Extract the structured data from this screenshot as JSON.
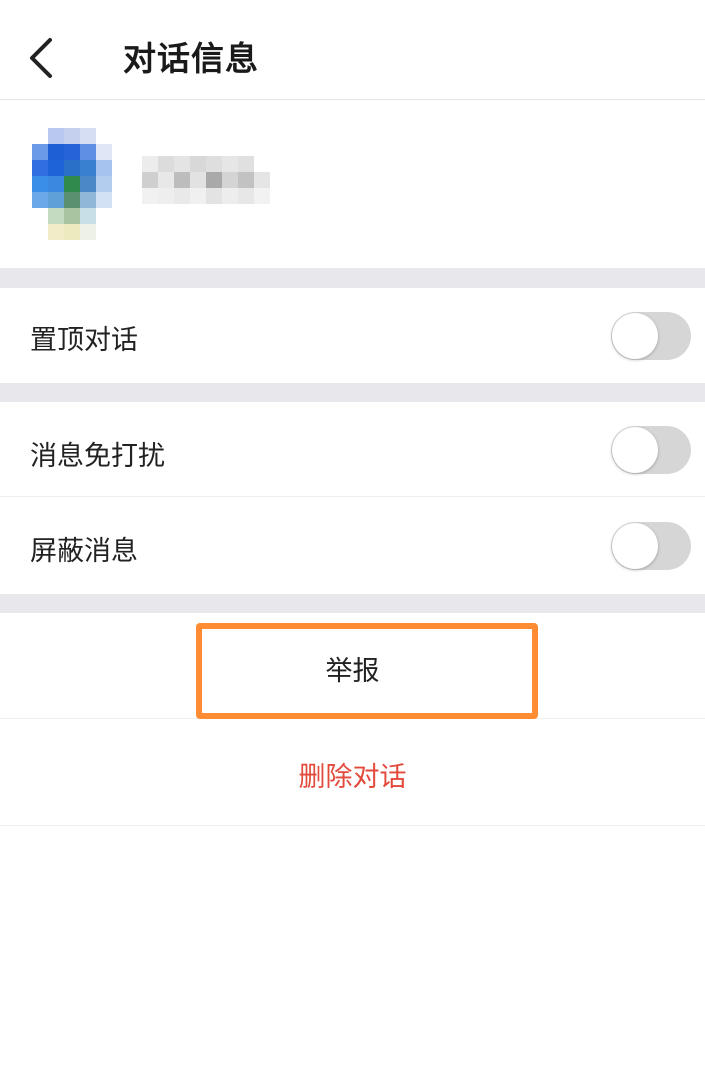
{
  "header": {
    "title": "对话信息",
    "back_icon": "chevron-left-icon"
  },
  "profile": {
    "avatar_icon": "blurred-avatar",
    "name_obscured": true
  },
  "settings": {
    "pin": {
      "label": "置顶对话",
      "enabled": false
    },
    "mute": {
      "label": "消息免打扰",
      "enabled": false
    },
    "block": {
      "label": "屏蔽消息",
      "enabled": false
    }
  },
  "actions": {
    "report": {
      "label": "举报"
    },
    "delete": {
      "label": "删除对话",
      "color": "#e24a3b"
    }
  },
  "colors": {
    "highlight": "#ff8c33",
    "toggle_off": "#d6d6d6",
    "section_gap": "#e8e8ec"
  }
}
